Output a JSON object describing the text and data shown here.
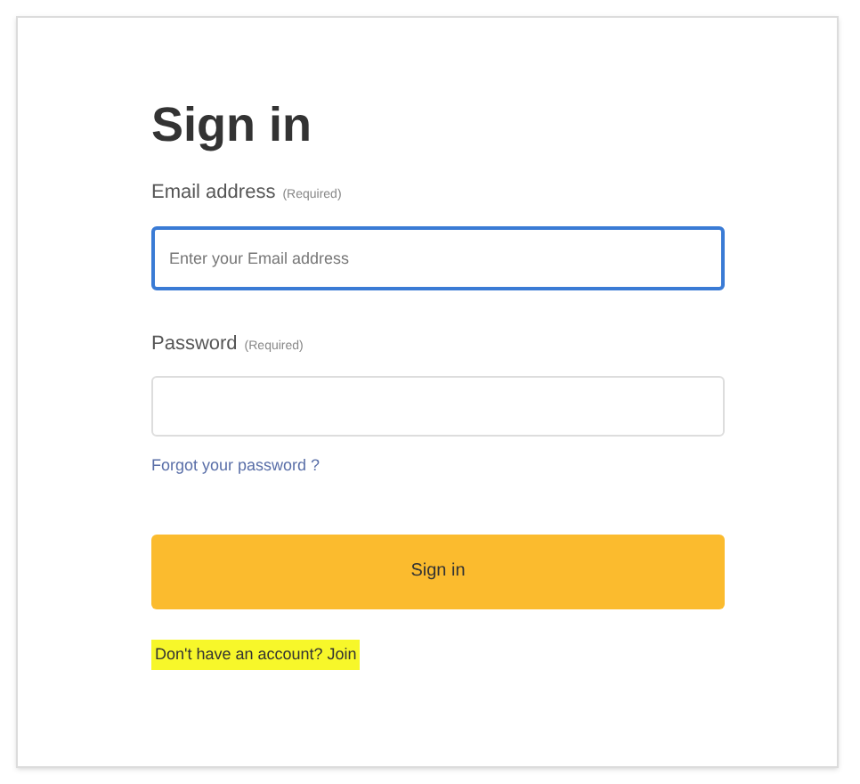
{
  "title": "Sign in",
  "fields": [
    {
      "label": "Email address",
      "note": "(Required)",
      "placeholder": "Enter your Email address",
      "focused": true
    },
    {
      "label": "Password",
      "note": "(Required)",
      "focused": false
    }
  ],
  "forgot_link": "Forgot your password ?",
  "submit_button": "Sign in",
  "signup_prompt": {
    "text": "Don't have an account? Join",
    "highlighted": true
  }
}
